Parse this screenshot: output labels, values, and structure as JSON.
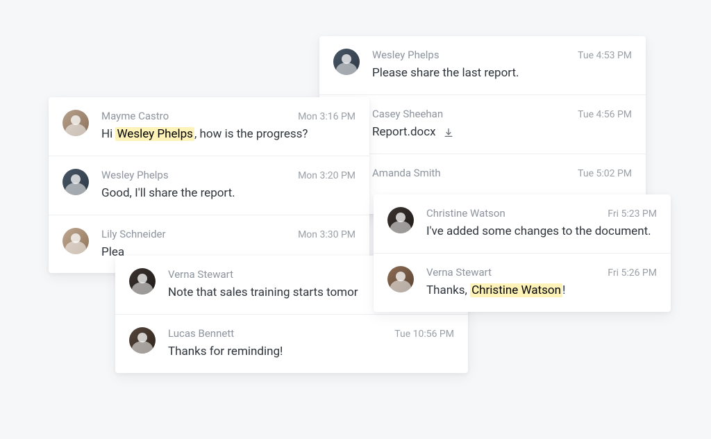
{
  "cards": [
    {
      "id": "card-right",
      "messages": [
        {
          "author": "Wesley Phelps",
          "time": "Tue 4:53 PM",
          "body": "Please share the last report."
        },
        {
          "author": "Casey Sheehan",
          "time": "Tue 4:56 PM",
          "file": "Report.docx"
        },
        {
          "author": "Amanda Smith",
          "time": "Tue 5:02 PM",
          "body": ""
        }
      ]
    },
    {
      "id": "card-left",
      "messages": [
        {
          "author": "Mayme Castro",
          "time": "Mon 3:16 PM",
          "body_pre": "Hi ",
          "mention": "Wesley Phelps",
          "body_post": ", how is the progress?"
        },
        {
          "author": "Wesley Phelps",
          "time": "Mon 3:20 PM",
          "body": "Good, I'll share the report."
        },
        {
          "author": "Lily Schneider",
          "time": "Mon 3:30 PM",
          "body": "Plea"
        }
      ]
    },
    {
      "id": "card-mid",
      "messages": [
        {
          "author": "Verna Stewart",
          "time": "",
          "body": "Note that sales training starts tomor"
        },
        {
          "author": "Lucas Bennett",
          "time": "Tue 10:56 PM",
          "body": "Thanks for reminding!"
        }
      ]
    },
    {
      "id": "card-front",
      "messages": [
        {
          "author": "Christine Watson",
          "time": "Fri 5:23 PM",
          "body": "I've added some changes to the document."
        },
        {
          "author": "Verna Stewart",
          "time": "Fri 5:26 PM",
          "body_pre": "Thanks, ",
          "mention": "Christine Watson",
          "body_post": "!"
        }
      ]
    }
  ]
}
